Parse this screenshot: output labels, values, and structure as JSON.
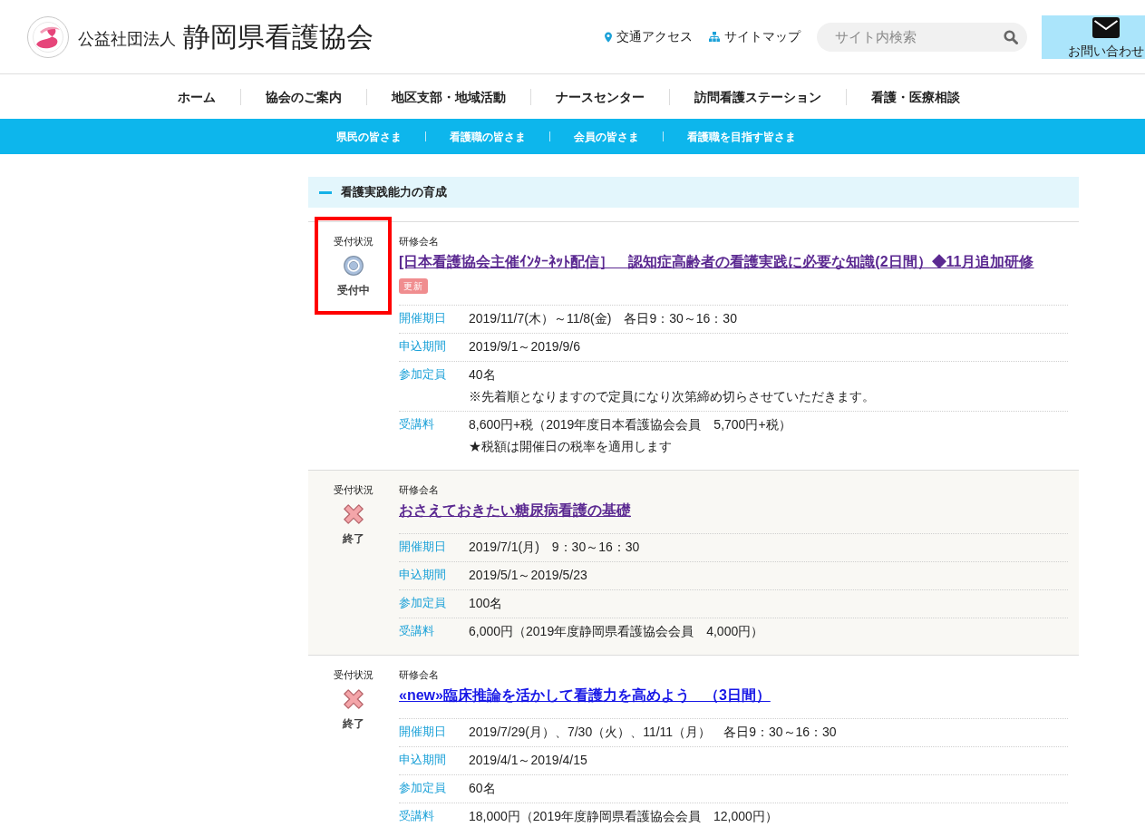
{
  "header": {
    "org_type": "公益社団法人",
    "org_name": "静岡県看護協会",
    "links": [
      {
        "kind": "pin",
        "label": "交通アクセス"
      },
      {
        "kind": "sitemap",
        "label": "サイトマップ"
      }
    ],
    "search": {
      "placeholder": "サイト内検索"
    },
    "contact": {
      "label": "お問い合わせ"
    }
  },
  "main_nav": [
    "ホーム",
    "協会のご案内",
    "地区支部・地域活動",
    "ナースセンター",
    "訪問看護ステーション",
    "看護・医療相談"
  ],
  "sub_nav": [
    "県民の皆さま",
    "看護職の皆さま",
    "会員の皆さま",
    "看護職を目指す皆さま"
  ],
  "section": {
    "title": "看護実践能力の育成",
    "expanded": true
  },
  "courses": [
    {
      "status_label": "受付状況",
      "kind": "open",
      "status_text": "受付中",
      "highlighted": true,
      "shaded": false,
      "name_label": "研修会名",
      "title": "[日本看護協会主催ｲﾝﾀｰﾈｯﾄ配信］　認知症高齢者の看護実践に必要な知識(2日間）◆11月追加研修",
      "visited": true,
      "badge": "更新",
      "details": [
        {
          "label": "開催期日",
          "lines": [
            "2019/11/7(木）～11/8(金)　各日9：30～16：30"
          ]
        },
        {
          "label": "申込期間",
          "lines": [
            "2019/9/1～2019/9/6"
          ]
        },
        {
          "label": "参加定員",
          "lines": [
            "40名",
            "※先着順となりますので定員になり次第締め切らさせていただきます。"
          ]
        },
        {
          "label": "受講料",
          "lines": [
            "8,600円+税（2019年度日本看護協会会員　5,700円+税）",
            "★税額は開催日の税率を適用します"
          ]
        }
      ]
    },
    {
      "status_label": "受付状況",
      "kind": "closed",
      "status_text": "終了",
      "highlighted": false,
      "shaded": true,
      "name_label": "研修会名",
      "title": "おさえておきたい糖尿病看護の基礎",
      "visited": true,
      "details": [
        {
          "label": "開催期日",
          "lines": [
            "2019/7/1(月)　9：30～16：30"
          ]
        },
        {
          "label": "申込期間",
          "lines": [
            "2019/5/1～2019/5/23"
          ]
        },
        {
          "label": "参加定員",
          "lines": [
            "100名"
          ]
        },
        {
          "label": "受講料",
          "lines": [
            "6,000円（2019年度静岡県看護協会会員　4,000円）"
          ]
        }
      ]
    },
    {
      "status_label": "受付状況",
      "kind": "closed",
      "status_text": "終了",
      "highlighted": false,
      "shaded": false,
      "name_label": "研修会名",
      "title": "«new»臨床推論を活かして看護力を高めよう　（3日間）",
      "visited": false,
      "details": [
        {
          "label": "開催期日",
          "lines": [
            "2019/7/29(月）、7/30（火）、11/11（月）　各日9：30～16：30"
          ]
        },
        {
          "label": "申込期間",
          "lines": [
            "2019/4/1～2019/4/15"
          ]
        },
        {
          "label": "参加定員",
          "lines": [
            "60名"
          ]
        },
        {
          "label": "受講料",
          "lines": [
            "18,000円（2019年度静岡県看護協会会員　12,000円）"
          ]
        }
      ]
    }
  ]
}
